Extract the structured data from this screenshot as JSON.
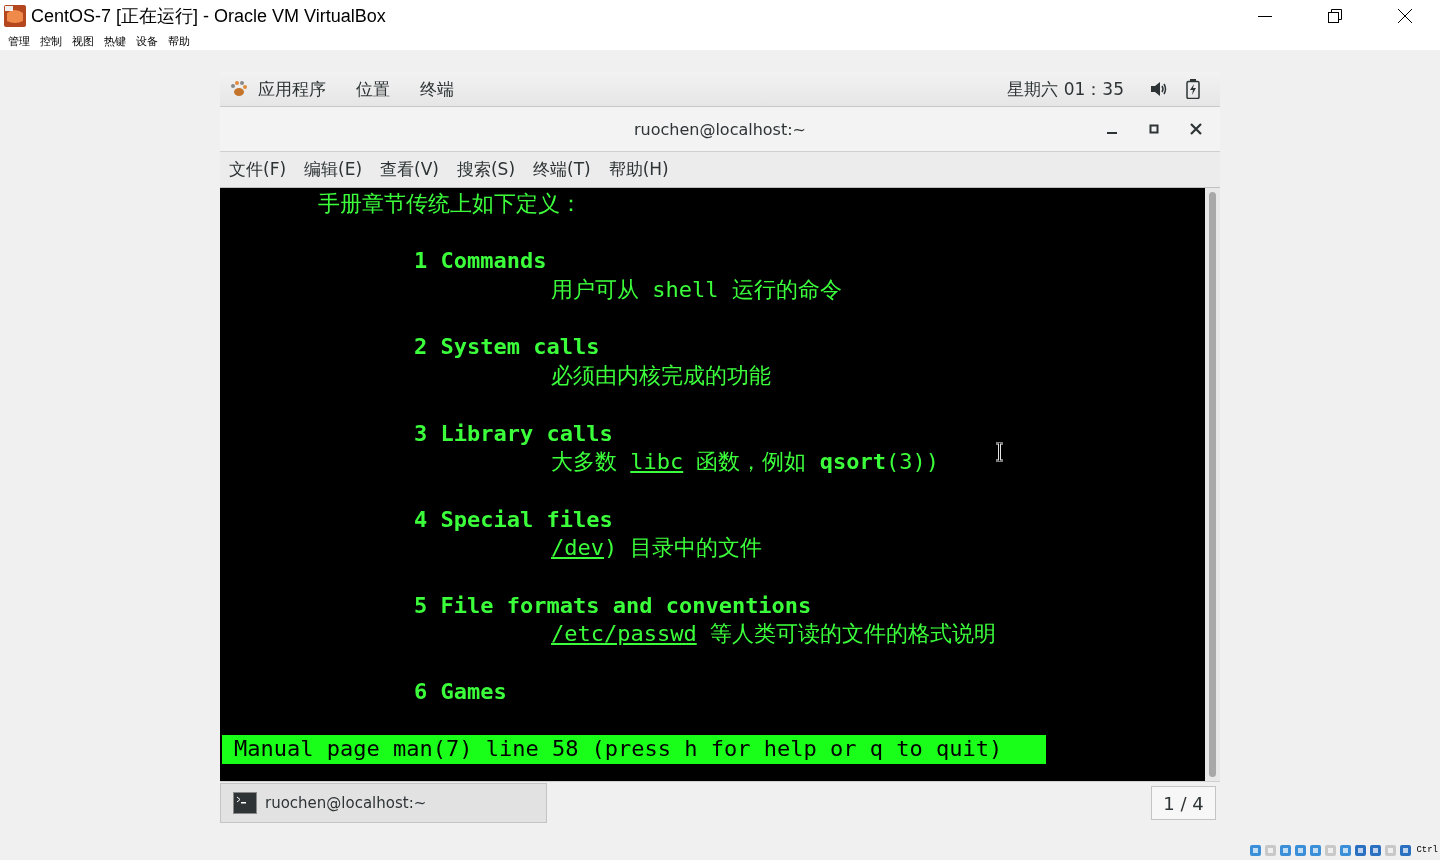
{
  "window": {
    "title": "CentOS-7 [正在运行] - Oracle VM VirtualBox",
    "menu": [
      "管理",
      "控制",
      "视图",
      "热键",
      "设备",
      "帮助"
    ]
  },
  "gnome_top_bar": {
    "menus": [
      "应用程序",
      "位置",
      "终端"
    ],
    "clock": "星期六 01：35"
  },
  "terminal": {
    "title": "ruochen@localhost:~",
    "menu": [
      "文件(F)",
      "编辑(E)",
      "查看(V)",
      "搜索(S)",
      "终端(T)",
      "帮助(H)"
    ],
    "lines": [
      {
        "kind": "intro",
        "segments": [
          {
            "kind": "text",
            "text": "手册章节传统上如下定义："
          }
        ]
      },
      {
        "kind": "heading",
        "segments": [
          {
            "kind": "text",
            "text": "1 Commands"
          }
        ]
      },
      {
        "kind": "desc",
        "segments": [
          {
            "kind": "text",
            "text": "用户可从 shell 运行的命令"
          }
        ]
      },
      {
        "kind": "heading",
        "segments": [
          {
            "kind": "text",
            "text": "2 System calls"
          }
        ]
      },
      {
        "kind": "desc",
        "segments": [
          {
            "kind": "text",
            "text": "必须由内核完成的功能"
          }
        ]
      },
      {
        "kind": "heading",
        "segments": [
          {
            "kind": "text",
            "text": "3 Library calls"
          }
        ]
      },
      {
        "kind": "desc",
        "segments": [
          {
            "kind": "text",
            "text": "大多数 "
          },
          {
            "kind": "reference",
            "text": "libc"
          },
          {
            "kind": "text",
            "text": " 函数，例如 "
          },
          {
            "kind": "command",
            "text": "qsort"
          },
          {
            "kind": "text",
            "text": "(3))"
          }
        ]
      },
      {
        "kind": "heading",
        "segments": [
          {
            "kind": "text",
            "text": "4 Special files"
          }
        ]
      },
      {
        "kind": "desc",
        "segments": [
          {
            "kind": "reference",
            "text": "/dev"
          },
          {
            "kind": "text",
            "text": ") 目录中的文件"
          }
        ]
      },
      {
        "kind": "heading",
        "segments": [
          {
            "kind": "text",
            "text": "5 File formats and conventions"
          }
        ]
      },
      {
        "kind": "desc",
        "segments": [
          {
            "kind": "reference",
            "text": "/etc/passwd"
          },
          {
            "kind": "text",
            "text": " 等人类可读的文件的格式说明"
          }
        ]
      },
      {
        "kind": "heading",
        "segments": [
          {
            "kind": "text",
            "text": "6 Games"
          }
        ]
      }
    ],
    "status_line": "Manual page man(7) line 58 (press h for help or q to quit)"
  },
  "taskbar": {
    "task": {
      "label": "ruochen@localhost:~",
      "selected": true
    },
    "workspace": "1 / 4"
  },
  "host_status": {
    "key_label": "Ctrl"
  }
}
